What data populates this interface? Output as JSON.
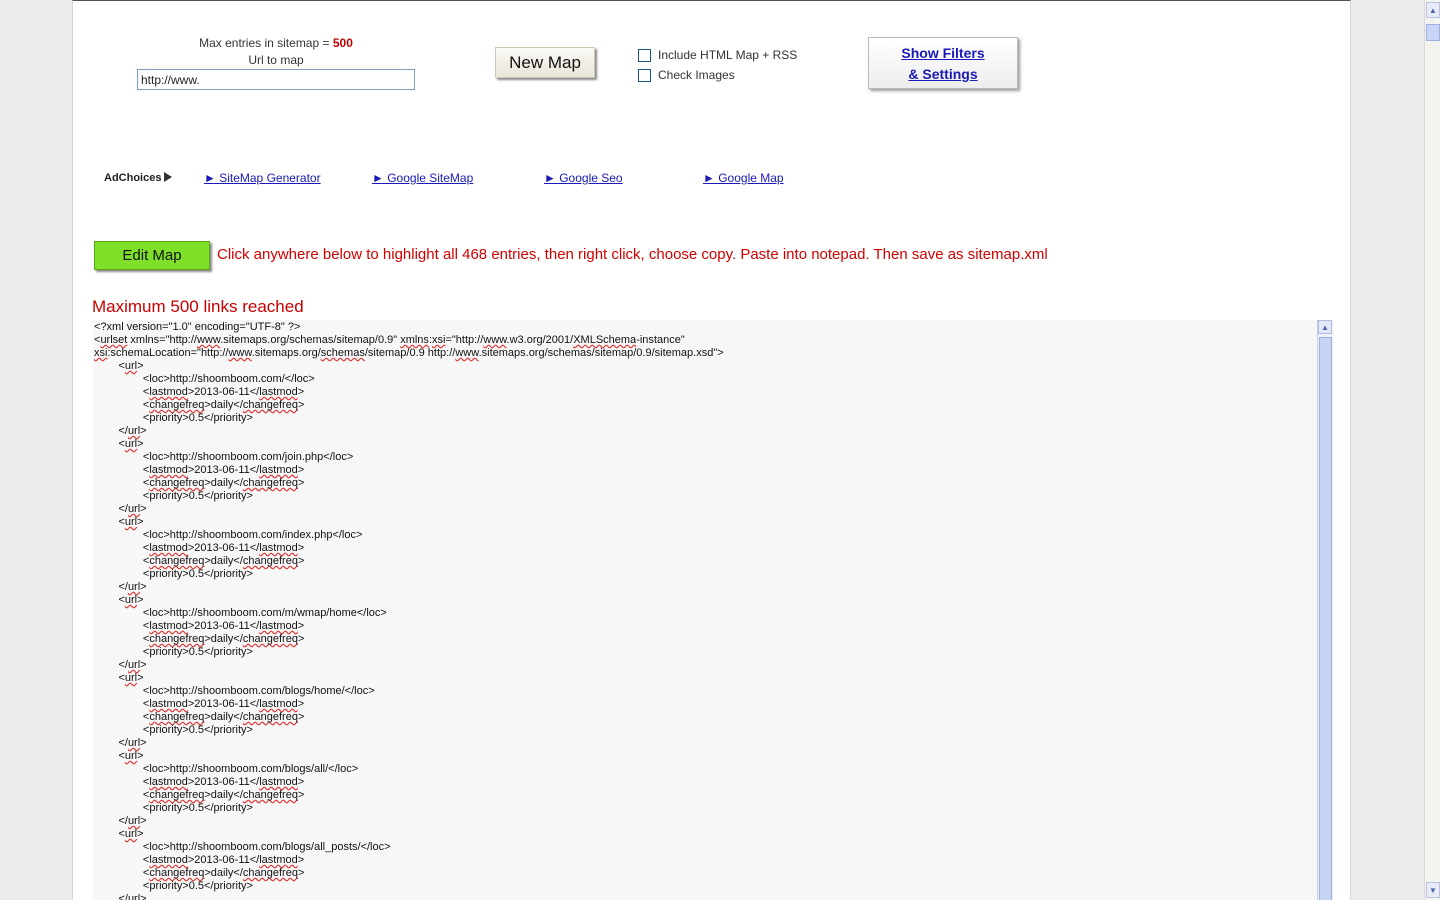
{
  "form": {
    "max_entries_label": "Max entries in sitemap =",
    "max_entries_value": "500",
    "url_label": "Url to map",
    "url_value": "http://www."
  },
  "buttons": {
    "new_map": "New Map",
    "edit_map": "Edit Map",
    "show_filters_line1": "Show Filters",
    "show_filters_line2": "& Settings"
  },
  "options": {
    "include_html": "Include HTML Map + RSS",
    "check_images": "Check Images"
  },
  "ads": {
    "adchoices": "AdChoices",
    "links": [
      "► SiteMap Generator",
      "► Google SiteMap",
      "► Google Seo",
      "► Google Map"
    ]
  },
  "messages": {
    "instructions": "Click anywhere below to highlight all 468 entries, then right click, choose copy. Paste into notepad. Then save as sitemap.xml",
    "max_reached": "Maximum 500 links reached"
  },
  "xml": {
    "decl": "<?xml version=\"1.0\" encoding=\"UTF-8\" ?>",
    "urlset_open": "<urlset xmlns=\"http://www.sitemaps.org/schemas/sitemap/0.9\" xmlns:xsi=\"http://www.w3.org/2001/XMLSchema-instance\"",
    "schema_location": "xsi:schemaLocation=\"http://www.sitemaps.org/schemas/sitemap/0.9 http://www.sitemaps.org/schemas/sitemap/0.9/sitemap.xsd\">",
    "lastmod": "2013-06-11",
    "changefreq": "daily",
    "priority": "0.5",
    "locs": [
      "http://shoomboom.com/",
      "http://shoomboom.com/join.php",
      "http://shoomboom.com/index.php",
      "http://shoomboom.com/m/wmap/home",
      "http://shoomboom.com/blogs/home/",
      "http://shoomboom.com/blogs/all/",
      "http://shoomboom.com/blogs/all_posts/"
    ]
  }
}
